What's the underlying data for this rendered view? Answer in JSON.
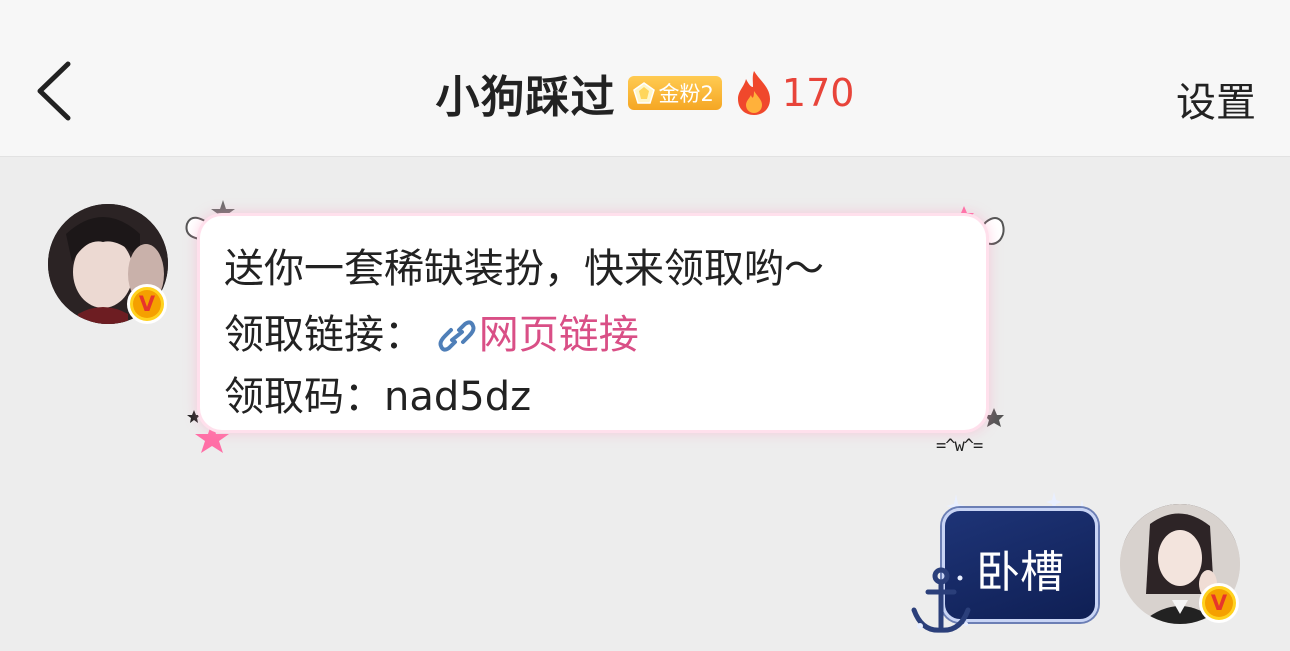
{
  "header": {
    "back_icon": "chevron-left-icon",
    "title": "小狗踩过",
    "fan_badge": "金粉2",
    "fire_count": "170",
    "settings_label": "设置"
  },
  "chat": {
    "incoming": {
      "line1": "送你一套稀缺装扮，快来领取哟～",
      "link_prefix": "领取链接：",
      "link_text": "网页链接",
      "code_line": "领取码：nad5dz",
      "emote": "=^w^="
    },
    "outgoing": {
      "sticker_text": "卧槽"
    }
  },
  "colors": {
    "header_bg": "#f7f7f7",
    "chat_bg": "#ededed",
    "link": "#d94f86",
    "fire": "#e8443a",
    "badge": "#f5a623"
  }
}
